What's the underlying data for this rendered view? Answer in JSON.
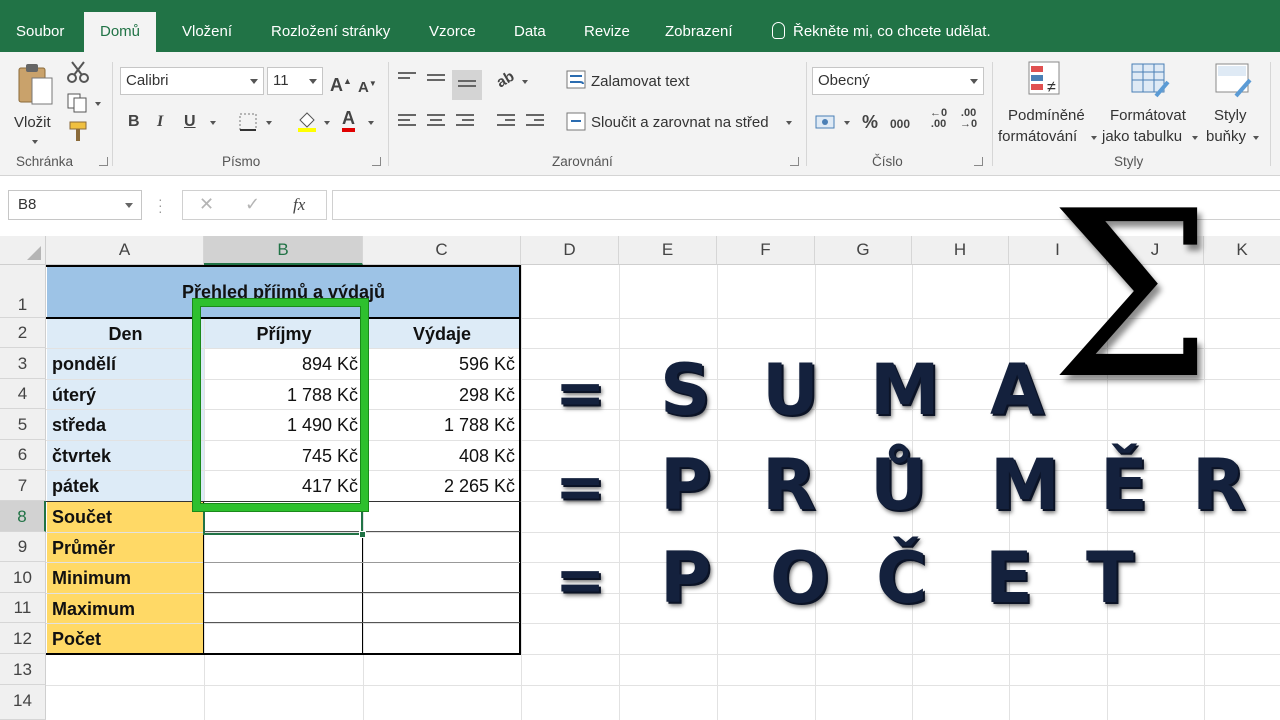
{
  "tabs": [
    "Soubor",
    "Domů",
    "Vložení",
    "Rozložení stránky",
    "Vzorce",
    "Data",
    "Revize",
    "Zobrazení"
  ],
  "active_tab": "Domů",
  "tell_me": "Řekněte mi, co chcete udělat.",
  "ribbon": {
    "clipboard": {
      "label": "Schránka",
      "paste": "Vložit"
    },
    "font": {
      "label": "Písmo",
      "name": "Calibri",
      "size": "11",
      "bold": "B",
      "italic": "I",
      "underline": "U"
    },
    "alignment": {
      "label": "Zarovnání",
      "wrap": "Zalamovat text",
      "merge": "Sloučit a zarovnat na střed"
    },
    "number": {
      "label": "Číslo",
      "format": "Obecný",
      "percent": "%",
      "thousands": "000"
    },
    "styles": {
      "label": "Styly",
      "conditional_1": "Podmíněné",
      "conditional_2": "formátování",
      "table_1": "Formátovat",
      "table_2": "jako tabulku",
      "cell_1": "Styly",
      "cell_2": "buňky"
    }
  },
  "formula_bar": {
    "name_box": "B8",
    "fx": "fx"
  },
  "columns": [
    "A",
    "B",
    "C",
    "D",
    "E",
    "F",
    "G",
    "H",
    "I",
    "J",
    "K"
  ],
  "rows": [
    "1",
    "2",
    "3",
    "4",
    "5",
    "6",
    "7",
    "8",
    "9",
    "10",
    "11",
    "12",
    "13",
    "14"
  ],
  "sheet": {
    "title": "Přehled příjmů a výdajů",
    "headers": [
      "Den",
      "Příjmy",
      "Výdaje"
    ],
    "data": [
      {
        "day": "pondělí",
        "income": "894 Kč",
        "expense": "596 Kč"
      },
      {
        "day": "úterý",
        "income": "1 788 Kč",
        "expense": "298 Kč"
      },
      {
        "day": "středa",
        "income": "1 490 Kč",
        "expense": "1 788 Kč"
      },
      {
        "day": "čtvrtek",
        "income": "745 Kč",
        "expense": "408 Kč"
      },
      {
        "day": "pátek",
        "income": "417 Kč",
        "expense": "2 265 Kč"
      }
    ],
    "summary": [
      "Součet",
      "Průměr",
      "Minimum",
      "Maximum",
      "Počet"
    ]
  },
  "overlay": {
    "sigma": "Σ",
    "eq": "=",
    "line1": [
      "S",
      "U",
      "M",
      "A"
    ],
    "line2": [
      "P",
      "R",
      "Ů",
      "M",
      "Ě",
      "R"
    ],
    "line3": [
      "P",
      "O",
      "Č",
      "E",
      "T"
    ]
  },
  "colors": {
    "excel_green": "#217346",
    "title_fill": "#9dc3e6",
    "header_fill": "#ddebf7",
    "summary_fill": "#ffd966",
    "highlight": "#2ec02e"
  }
}
